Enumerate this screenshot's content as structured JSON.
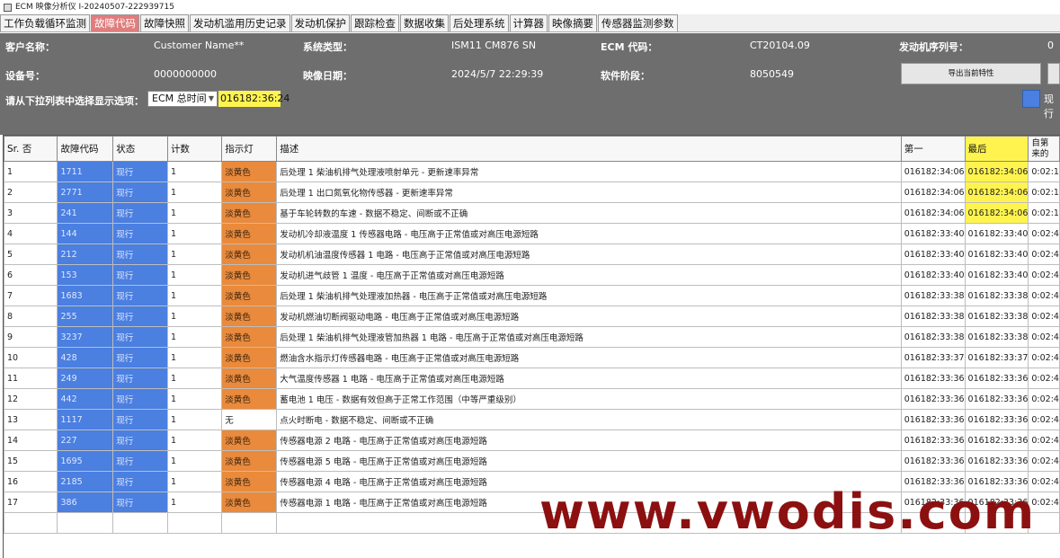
{
  "window": {
    "title": "ECM 映像分析仪 I-20240507-222939715"
  },
  "tabs": [
    "工作负载循环监测",
    "故障代码",
    "故障快照",
    "发动机滥用历史记录",
    "发动机保护",
    "跟踪检查",
    "数据收集",
    "后处理系统",
    "计算器",
    "映像摘要",
    "传感器监测参数"
  ],
  "active_tab": "故障代码",
  "info": {
    "customer_label": "客户名称：",
    "customer_value": "Customer Name**",
    "system_label": "系统类型：",
    "system_value": "ISM11 CM876 SN",
    "ecm_label": "ECM 代码：",
    "ecm_value": "CT20104.09",
    "serial_label": "发动机序列号：",
    "serial_value": "0",
    "device_label": "设备号：",
    "device_value": "0000000000",
    "date_label": "映像日期：",
    "date_value": "2024/5/7 22:29:39",
    "phase_label": "软件阶段：",
    "phase_value": "8050549",
    "export_label": "导出当前特性",
    "select_prompt": "请从下拉列表中选择显示选项：",
    "select_value": "ECM 总时间",
    "time_value": "016182:36:24",
    "legend_label": "现行"
  },
  "columns": [
    "Sr. 否",
    "故障代码",
    "状态",
    "计数",
    "指示灯",
    "描述",
    "第一",
    "最后",
    "自第\n来的"
  ],
  "rows": [
    [
      "1",
      "1711",
      "现行",
      "1",
      "淡黄色",
      "后处理 1 柴油机排气处理液喷射单元 - 更新速率异常",
      "016182:34:06",
      "016182:34:06",
      "0:02:1"
    ],
    [
      "2",
      "2771",
      "现行",
      "1",
      "淡黄色",
      "后处理 1 出口氮氧化物传感器 - 更新速率异常",
      "016182:34:06",
      "016182:34:06",
      "0:02:1"
    ],
    [
      "3",
      "241",
      "现行",
      "1",
      "淡黄色",
      "基于车轮转数的车速 - 数据不稳定、间断或不正确",
      "016182:34:06",
      "016182:34:06",
      "0:02:1"
    ],
    [
      "4",
      "144",
      "现行",
      "1",
      "淡黄色",
      "发动机冷却液温度 1 传感器电路 - 电压高于正常值或对高压电源短路",
      "016182:33:40",
      "016182:33:40",
      "0:02:4"
    ],
    [
      "5",
      "212",
      "现行",
      "1",
      "淡黄色",
      "发动机机油温度传感器 1 电路 - 电压高于正常值或对高压电源短路",
      "016182:33:40",
      "016182:33:40",
      "0:02:4"
    ],
    [
      "6",
      "153",
      "现行",
      "1",
      "淡黄色",
      "发动机进气歧管 1 温度 - 电压高于正常值或对高压电源短路",
      "016182:33:40",
      "016182:33:40",
      "0:02:4"
    ],
    [
      "7",
      "1683",
      "现行",
      "1",
      "淡黄色",
      "后处理 1 柴油机排气处理液加热器 - 电压高于正常值或对高压电源短路",
      "016182:33:38",
      "016182:33:38",
      "0:02:4"
    ],
    [
      "8",
      "255",
      "现行",
      "1",
      "淡黄色",
      "发动机燃油切断阀驱动电路 - 电压高于正常值或对高压电源短路",
      "016182:33:38",
      "016182:33:38",
      "0:02:4"
    ],
    [
      "9",
      "3237",
      "现行",
      "1",
      "淡黄色",
      "后处理 1 柴油机排气处理液管加热器 1 电路 - 电压高于正常值或对高压电源短路",
      "016182:33:38",
      "016182:33:38",
      "0:02:4"
    ],
    [
      "10",
      "428",
      "现行",
      "1",
      "淡黄色",
      "燃油含水指示灯传感器电路 - 电压高于正常值或对高压电源短路",
      "016182:33:37",
      "016182:33:37",
      "0:02:4"
    ],
    [
      "11",
      "249",
      "现行",
      "1",
      "淡黄色",
      "大气温度传感器 1 电路 - 电压高于正常值或对高压电源短路",
      "016182:33:36",
      "016182:33:36",
      "0:02:4"
    ],
    [
      "12",
      "442",
      "现行",
      "1",
      "淡黄色",
      "蓄电池 1 电压 - 数据有效但高于正常工作范围（中等严重级别）",
      "016182:33:36",
      "016182:33:36",
      "0:02:4"
    ],
    [
      "13",
      "1117",
      "现行",
      "1",
      "无",
      "点火时断电 - 数据不稳定、间断或不正确",
      "016182:33:36",
      "016182:33:36",
      "0:02:4"
    ],
    [
      "14",
      "227",
      "现行",
      "1",
      "淡黄色",
      "传感器电源 2 电路 - 电压高于正常值或对高压电源短路",
      "016182:33:36",
      "016182:33:36",
      "0:02:4"
    ],
    [
      "15",
      "1695",
      "现行",
      "1",
      "淡黄色",
      "传感器电源 5 电路 - 电压高于正常值或对高压电源短路",
      "016182:33:36",
      "016182:33:36",
      "0:02:4"
    ],
    [
      "16",
      "2185",
      "现行",
      "1",
      "淡黄色",
      "传感器电源 4 电路 - 电压高于正常值或对高压电源短路",
      "016182:33:36",
      "016182:33:36",
      "0:02:4"
    ],
    [
      "17",
      "386",
      "现行",
      "1",
      "淡黄色",
      "传感器电源 1 电路 - 电压高于正常值或对高压电源短路",
      "016182:33:36",
      "016182:33:36",
      "0:02:4"
    ]
  ],
  "highlight_last_rows": 3,
  "colors": {
    "status": "#4b7fe0",
    "lamp": "#e98a3c",
    "highlight": "#fff44f",
    "active_tab": "#e07d7d",
    "header": "#6e6e6e"
  },
  "watermark": "www.vwodis.com"
}
